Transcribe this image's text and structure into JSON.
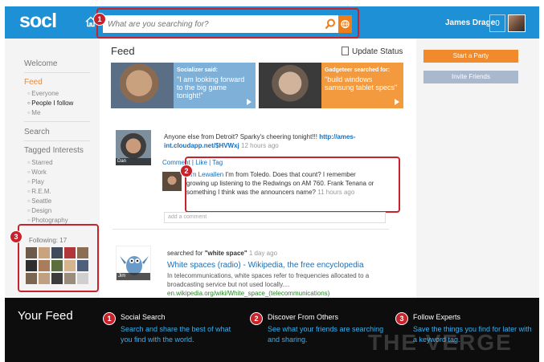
{
  "app": {
    "logo": "socl"
  },
  "search": {
    "placeholder": "What are you searching for?"
  },
  "header": {
    "user_name": "James Drage",
    "notification_count": "0"
  },
  "callouts": {
    "search": "1",
    "comment": "2",
    "following": "3"
  },
  "sidebar": {
    "welcome": "Welcome",
    "feed": "Feed",
    "feed_items": [
      "Everyone",
      "People I follow",
      "Me"
    ],
    "search": "Search",
    "tagged_interests": "Tagged Interests",
    "interests": [
      "Starred",
      "Work",
      "Play",
      "R.E.M.",
      "Seattle",
      "Design",
      "Photography"
    ],
    "following_label": "Following: 17"
  },
  "main": {
    "title": "Feed",
    "update_status": "Update Status",
    "cards": [
      {
        "who": "Socializer said:",
        "text": "\"I am looking forward to the big game tonight!\""
      },
      {
        "who": "Gadgeteer searched for:",
        "text": "\"build windows samsung tablet specs\""
      }
    ],
    "post": {
      "author_caption": "Dan",
      "text": "Anyone else from Detroit? Sparky's cheering tonight!!!",
      "link": "http://ames-int.cloudapp.net/$HVWxj",
      "time": "12 hours ago",
      "actions": [
        "Comment",
        "Like",
        "Tag"
      ],
      "comment": {
        "author": "Jim Lewallen",
        "text": "I'm from Toledo. Does that count? I remember growing up listening to the Redwings on AM 760. Frank Tenana or something I think was the announcers name?",
        "time": "11 hours ago"
      },
      "add_comment_placeholder": "add a comment"
    },
    "search_post": {
      "author_caption": "Jim",
      "searched_for_prefix": "searched for",
      "query": "\"white space\"",
      "time": "1 day ago",
      "result_title": "White spaces (radio) - Wikipedia, the free encyclopedia",
      "result_snippet": "In telecommunications, white spaces refer to frequencies allocated to a broadcasting service but not used locally....",
      "result_url": "en.wikipedia.org/wiki/White_space_(telecommunications)"
    }
  },
  "right": {
    "start_party": "Start a Party",
    "invite_friends": "Invite Friends"
  },
  "promo": {
    "heading": "Your Feed",
    "items": [
      {
        "num": "1",
        "title": "Social Search",
        "desc": "Search and share the best of what you find with the world."
      },
      {
        "num": "2",
        "title": "Discover From Others",
        "desc": "See what your friends are searching and sharing."
      },
      {
        "num": "3",
        "title": "Follow Experts",
        "desc": "Save the things you find for later with a keyword tag."
      }
    ]
  },
  "watermark": "THE VERGE",
  "colors": {
    "brand_blue": "#1e90d6",
    "accent_orange": "#f08a2c",
    "callout_red": "#c8232c",
    "link_blue": "#1a6fb8"
  }
}
